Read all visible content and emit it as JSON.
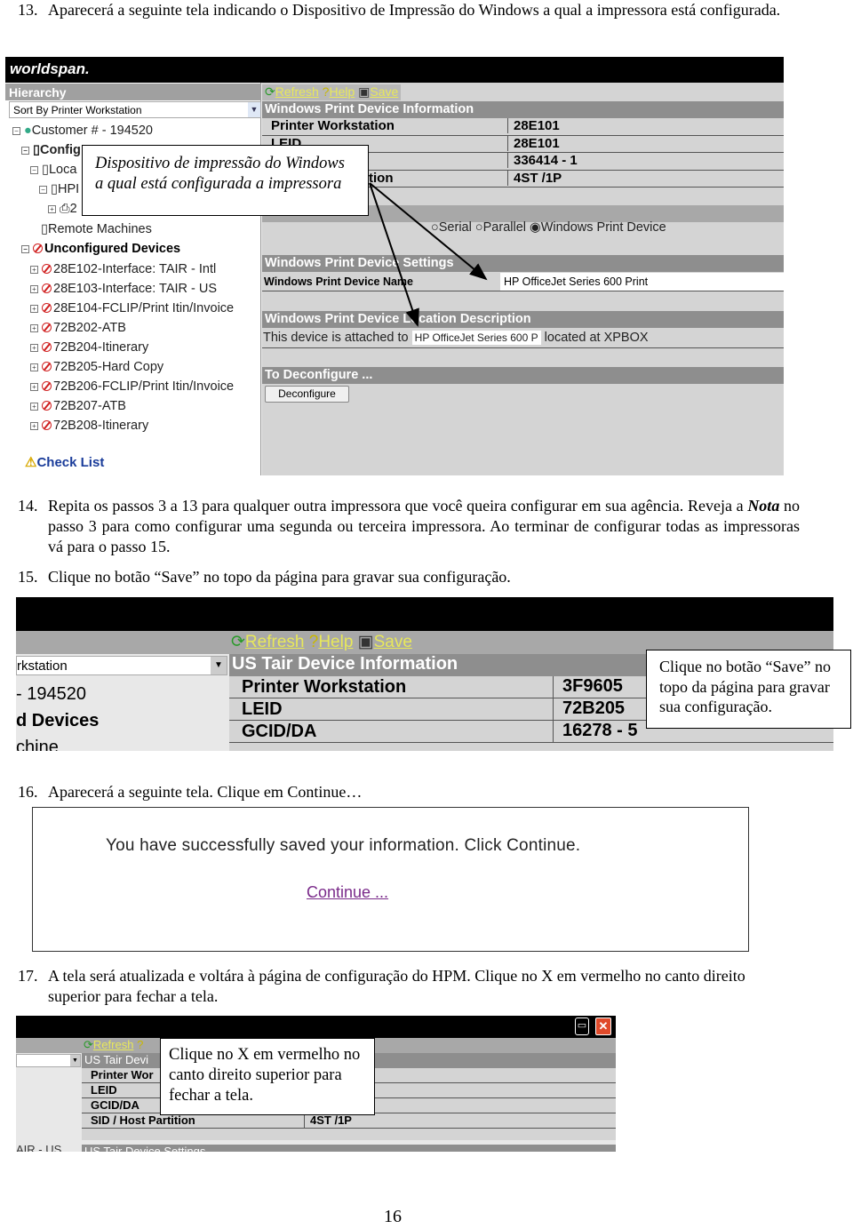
{
  "steps": [
    {
      "num": "13.",
      "text": "Aparecerá a seguinte tela indicando o Dispositivo de Impressão do Windows a qual a impressora está configurada."
    },
    {
      "num": "14.",
      "text_before": "Repita os passos 3 a 13 para qualquer outra impressora que você queira configurar em sua agência. Reveja a ",
      "emphasis": "Nota",
      "text_after": " no passo 3 para como configurar uma segunda ou terceira impressora. Ao terminar de configurar todas as impressoras vá para o passo 15."
    },
    {
      "num": "15.",
      "text": "Clique no botão “Save” no topo da página para gravar sua configuração."
    },
    {
      "num": "16.",
      "text": "Aparecerá a seguinte tela. Clique em Continue…"
    },
    {
      "num": "17.",
      "text": "A tela será atualizada e voltára à página de configuração do HPM. Clique no X em vermelho no canto direito superior para fechar a tela."
    }
  ],
  "shot1": {
    "logo": "worldspan.",
    "hierarchy_title": "Hierarchy",
    "sort_select": "Sort By Printer Workstation",
    "tree": [
      "Customer # - 194520",
      "Config",
      "Loca",
      "HPI",
      "2",
      "Remote Machines",
      "Unconfigured Devices",
      "28E102-Interface: TAIR - Intl",
      "28E103-Interface: TAIR - US",
      "28E104-FCLIP/Print Itin/Invoice",
      "72B202-ATB",
      "72B204-Itinerary",
      "72B205-Hard Copy",
      "72B206-FCLIP/Print Itin/Invoice",
      "72B207-ATB",
      "72B208-Itinerary"
    ],
    "check_list": "Check List",
    "toolbar": {
      "refresh": "Refresh",
      "help": "Help",
      "save": "Save"
    },
    "info_header": "Windows Print Device Information",
    "info_rows": [
      {
        "label": "Printer Workstation",
        "value": "28E101"
      },
      {
        "label": "LEID",
        "value": "28E101"
      },
      {
        "label": "",
        "value": "336414 - 1"
      },
      {
        "label": "tion",
        "value": "4ST /1P"
      }
    ],
    "radios": [
      {
        "label": "Serial",
        "checked": false
      },
      {
        "label": "Parallel",
        "checked": false
      },
      {
        "label": "Windows Print Device",
        "checked": true
      }
    ],
    "settings_header": "Windows Print Device Settings",
    "device_name_label": "Windows Print Device Name",
    "device_name_value": "HP OfficeJet Series 600 Print",
    "location_header": "Windows Print Device Location Description",
    "location_prefix": "This device is attached to",
    "location_value": "HP OfficeJet Series 600 P",
    "location_suffix": "located at XPBOX",
    "deconfigure_header": "To Deconfigure ...",
    "deconfigure_button": "Deconfigure",
    "callout": "Dispositivo de impressão do Windows a qual está configurada a impressora"
  },
  "shot2": {
    "toolbar": {
      "refresh": "Refresh",
      "help": "Help",
      "save": "Save"
    },
    "left_select": "rkstation",
    "left_rows": [
      "- 194520",
      "d Devices",
      "chine"
    ],
    "header": "US Tair Device Information",
    "rows": [
      {
        "label": "Printer Workstation",
        "value": "3F9605"
      },
      {
        "label": "LEID",
        "value": "72B205"
      },
      {
        "label": "GCID/DA",
        "value": "16278 - 5"
      }
    ],
    "callout": "Clique no botão “Save” no topo da página para gravar sua configuração."
  },
  "shot3": {
    "message": "You have successfully saved your information. Click Continue.",
    "link": "Continue ..."
  },
  "shot4": {
    "refresh": "Refresh",
    "header": "US Tair Devi",
    "rows": [
      "Printer Wor",
      "LEID",
      "GCID/DA",
      "SID / Host Partition"
    ],
    "sid_value": "4ST /1P",
    "left_text": "AIR - US",
    "settings_header": "US Tair Device Settings",
    "callout": "Clique no X em vermelho no canto direito superior para fechar a tela.",
    "close_color": "#e04a2a"
  },
  "page_number": "16"
}
